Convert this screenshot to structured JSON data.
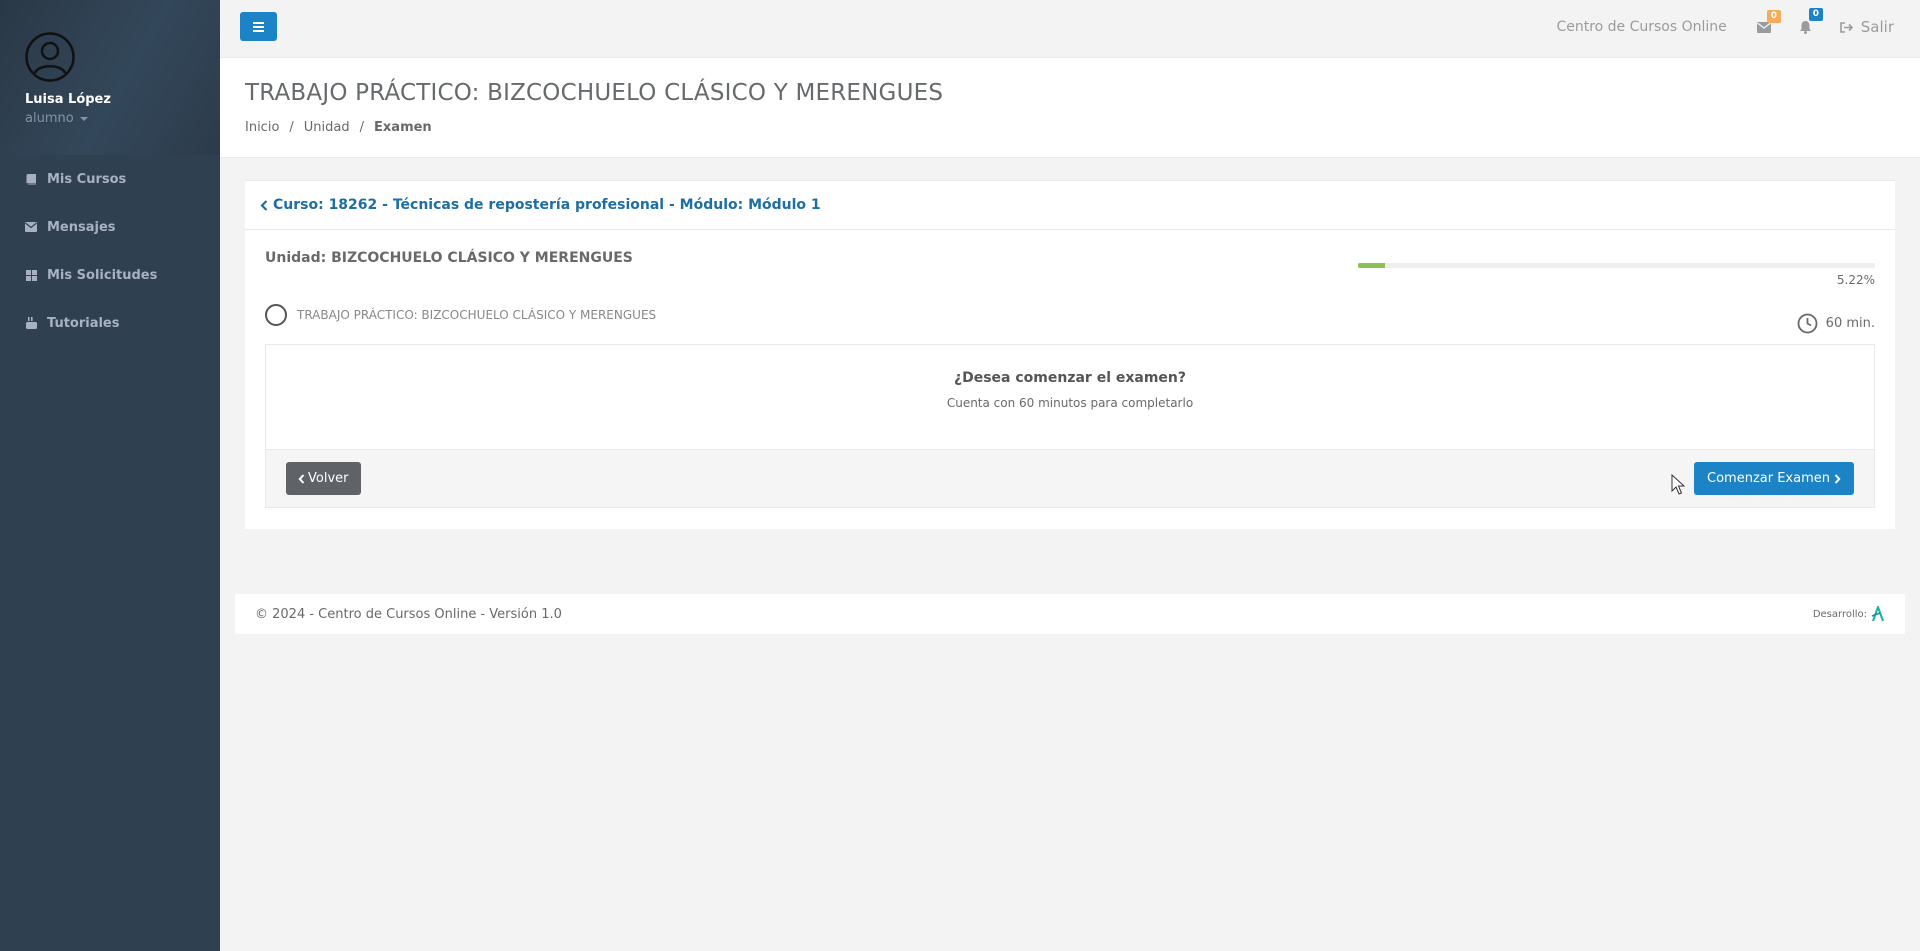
{
  "sidebar": {
    "user_name": "Luisa López",
    "user_role": "alumno",
    "items": [
      {
        "label": "Mis Cursos",
        "icon": "book-icon"
      },
      {
        "label": "Mensajes",
        "icon": "envelope-icon"
      },
      {
        "label": "Mis Solicitudes",
        "icon": "grid-icon"
      },
      {
        "label": "Tutoriales",
        "icon": "youtube-icon"
      }
    ]
  },
  "topbar": {
    "site_name": "Centro de Cursos Online",
    "messages_count": "0",
    "notifications_count": "0",
    "logout_label": "Salir"
  },
  "heading": {
    "title": "TRABAJO PRÁCTICO: BIZCOCHUELO CLÁSICO Y MERENGUES",
    "breadcrumb": [
      "Inicio",
      "Unidad",
      "Examen"
    ]
  },
  "course": {
    "header": "Curso: 18262 - Técnicas de repostería profesional - Módulo: Módulo 1",
    "unit_title": "Unidad: BIZCOCHUELO CLÁSICO Y MERENGUES",
    "progress": 5.22,
    "progress_label": "5.22%",
    "exam_name": "TRABAJO PRÁCTICO: BIZCOCHUELO CLÁSICO Y MERENGUES",
    "duration": "60 min.",
    "question": "¿Desea comenzar el examen?",
    "subtext": "Cuenta con 60 minutos para completarlo",
    "back_label": "Volver",
    "start_label": "Comenzar Examen"
  },
  "footer": {
    "copyright": "© 2024 - Centro de Cursos Online - Versión 1.0",
    "dev_label": "Desarrollo:"
  },
  "colors": {
    "sidebar": "#2f4050",
    "primary": "#1c84c6",
    "progress": "#8cc152",
    "badge_warning": "#f8ac59"
  }
}
